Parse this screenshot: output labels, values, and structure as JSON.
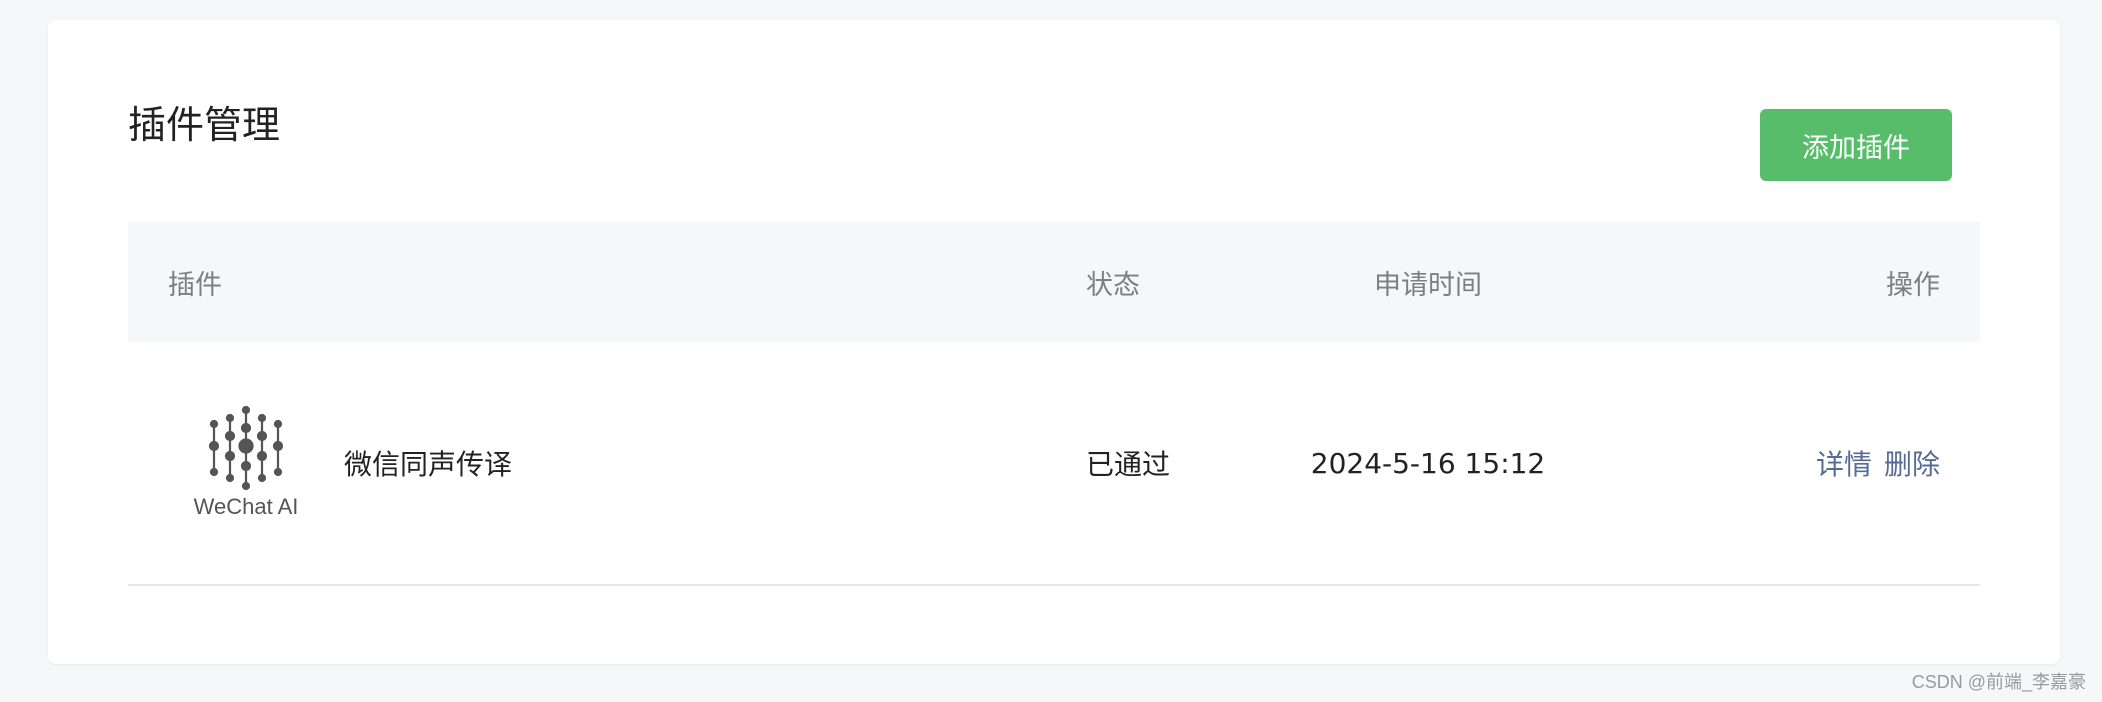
{
  "header": {
    "title": "插件管理",
    "add_button_label": "添加插件"
  },
  "table": {
    "columns": {
      "plugin": "插件",
      "status": "状态",
      "time": "申请时间",
      "ops": "操作"
    },
    "rows": [
      {
        "logo_text": "WeChat AI",
        "logo_icon": "wechat-ai-logo-icon",
        "name": "微信同声传译",
        "status": "已通过",
        "time": "2024-5-16 15:12",
        "detail_label": "详情",
        "delete_label": "删除"
      }
    ]
  },
  "watermark": "CSDN @前端_李嘉豪",
  "colors": {
    "accent_green": "#57bd6a",
    "link_blue": "#576b95",
    "background": "#f6f7f9"
  }
}
